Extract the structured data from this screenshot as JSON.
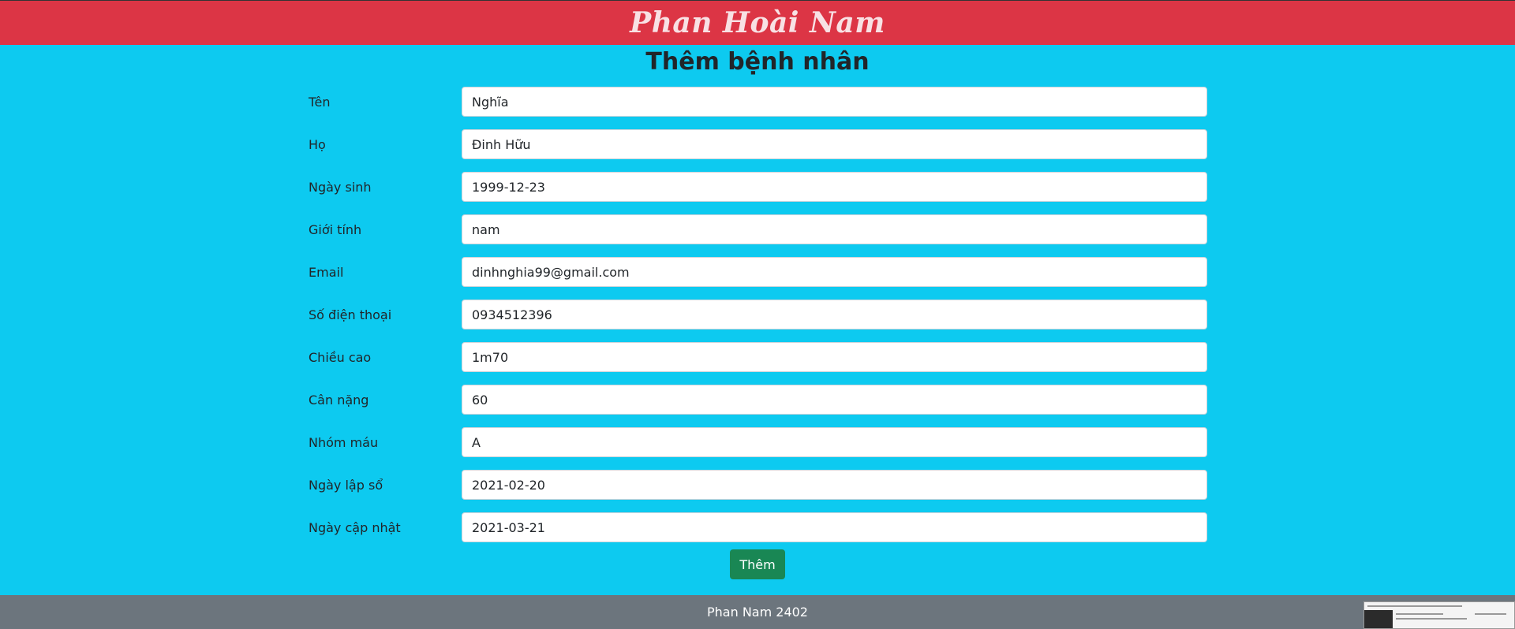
{
  "header": {
    "title": "Phan Hoài Nam"
  },
  "page": {
    "title": "Thêm bệnh nhân"
  },
  "form": {
    "fields": [
      {
        "label": "Tên",
        "value": "Nghĩa"
      },
      {
        "label": "Họ",
        "value": "Đinh Hữu"
      },
      {
        "label": "Ngày sinh",
        "value": "1999-12-23"
      },
      {
        "label": "Giới tính",
        "value": "nam"
      },
      {
        "label": "Email",
        "value": "dinhnghia99@gmail.com"
      },
      {
        "label": "Số điện thoại",
        "value": "0934512396"
      },
      {
        "label": "Chiều cao",
        "value": "1m70"
      },
      {
        "label": "Cân nặng",
        "value": "60"
      },
      {
        "label": "Nhóm máu",
        "value": "A"
      },
      {
        "label": "Ngày lập sổ",
        "value": "2021-02-20"
      },
      {
        "label": "Ngày cập nhật",
        "value": "2021-03-21"
      }
    ],
    "submit_label": "Thêm"
  },
  "footer": {
    "text": "Phan Nam 2402"
  },
  "colors": {
    "header_bg": "#dc3545",
    "page_bg": "#0dcaf0",
    "button_bg": "#198754",
    "footer_bg": "#6c757d"
  }
}
